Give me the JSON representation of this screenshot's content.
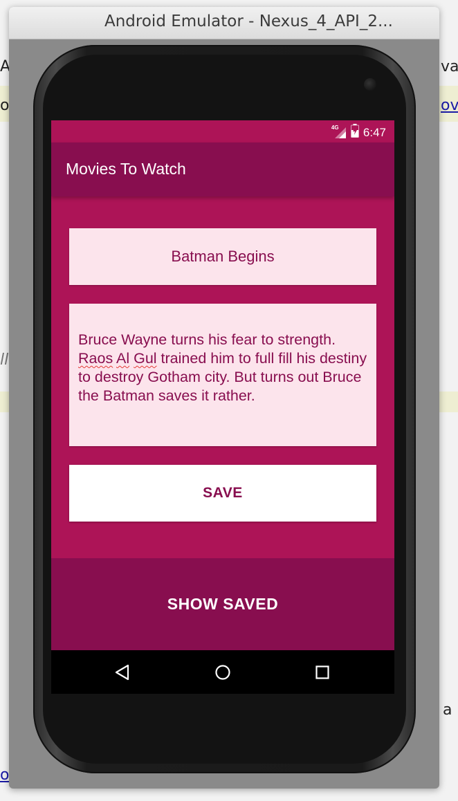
{
  "background": {
    "left_fragments": [
      "A",
      "o",
      "ll",
      "o"
    ],
    "right_fragments": [
      "va",
      "ov",
      "a"
    ]
  },
  "window": {
    "title": "Android Emulator - Nexus_4_API_2..."
  },
  "status_bar": {
    "network": "4G",
    "time": "6:47",
    "icons": [
      "signal-icon",
      "battery-icon"
    ]
  },
  "app": {
    "title": "Movies To Watch",
    "movie_title": "Batman Begins",
    "description": {
      "part1": "Bruce Wayne turns his fear to strength. ",
      "misspelled": [
        "Raos",
        "Al",
        "Gul"
      ],
      "part2": " trained him to full fill his destiny to destroy Gotham city. But turns out Bruce the Batman saves it rather."
    },
    "save_label": "SAVE",
    "show_saved_label": "SHOW SAVED"
  },
  "navigation": [
    "back-icon",
    "home-icon",
    "recents-icon"
  ],
  "colors": {
    "primary": "#ad1457",
    "primary_dark": "#880e4f",
    "field_background": "#fce4ec",
    "button_background": "#ffffff"
  }
}
